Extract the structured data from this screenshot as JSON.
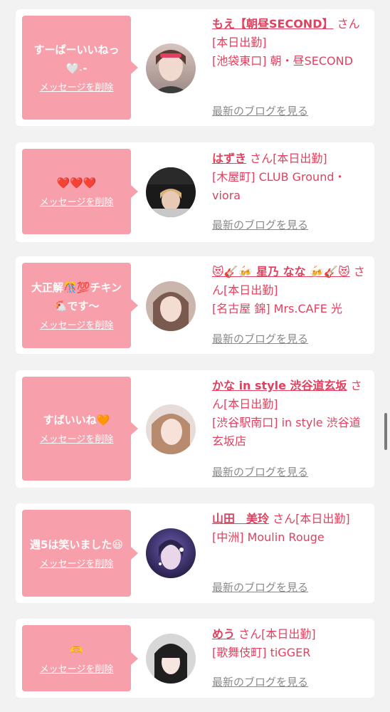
{
  "delete_label": "メッセージを削除",
  "blog_label": "最新のブログを見る",
  "accent_color": "#e2405e",
  "bubble_color": "#f7a0ab",
  "cards": [
    {
      "message": "すーぱーいいねっ🤍˴-",
      "name": "もえ【朝昼SECOND】",
      "suffix": "さん[本日出勤]",
      "shop": "[池袋東口] 朝・昼SECOND"
    },
    {
      "message": "❤️❤️❤️",
      "name": "はずき",
      "suffix": "さん[本日出勤]",
      "shop": "[木屋町] CLUB Ground・viora"
    },
    {
      "message": "大正解🎊💯チキン🐔です〜",
      "name": "😻🎸🍻 星乃 なな 🍻🎸😻",
      "suffix": "さん[本日出勤]",
      "shop": "[名古屋 錦] Mrs.CAFE 光"
    },
    {
      "message": "すばいいね🧡",
      "name": "かな in style 渋谷道玄坂",
      "suffix": "さん[本日出勤]",
      "shop": "[渋谷駅南口] in style 渋谷道玄坂店"
    },
    {
      "message": "週5は笑いました😆",
      "name": "山田　美玲",
      "suffix": "さん[本日出勤]",
      "shop": "[中洲] Moulin Rouge"
    },
    {
      "message": "🫶",
      "name": "めう",
      "suffix": "さん[本日出勤]",
      "shop": "[歌舞伎町] tiGGER"
    }
  ]
}
